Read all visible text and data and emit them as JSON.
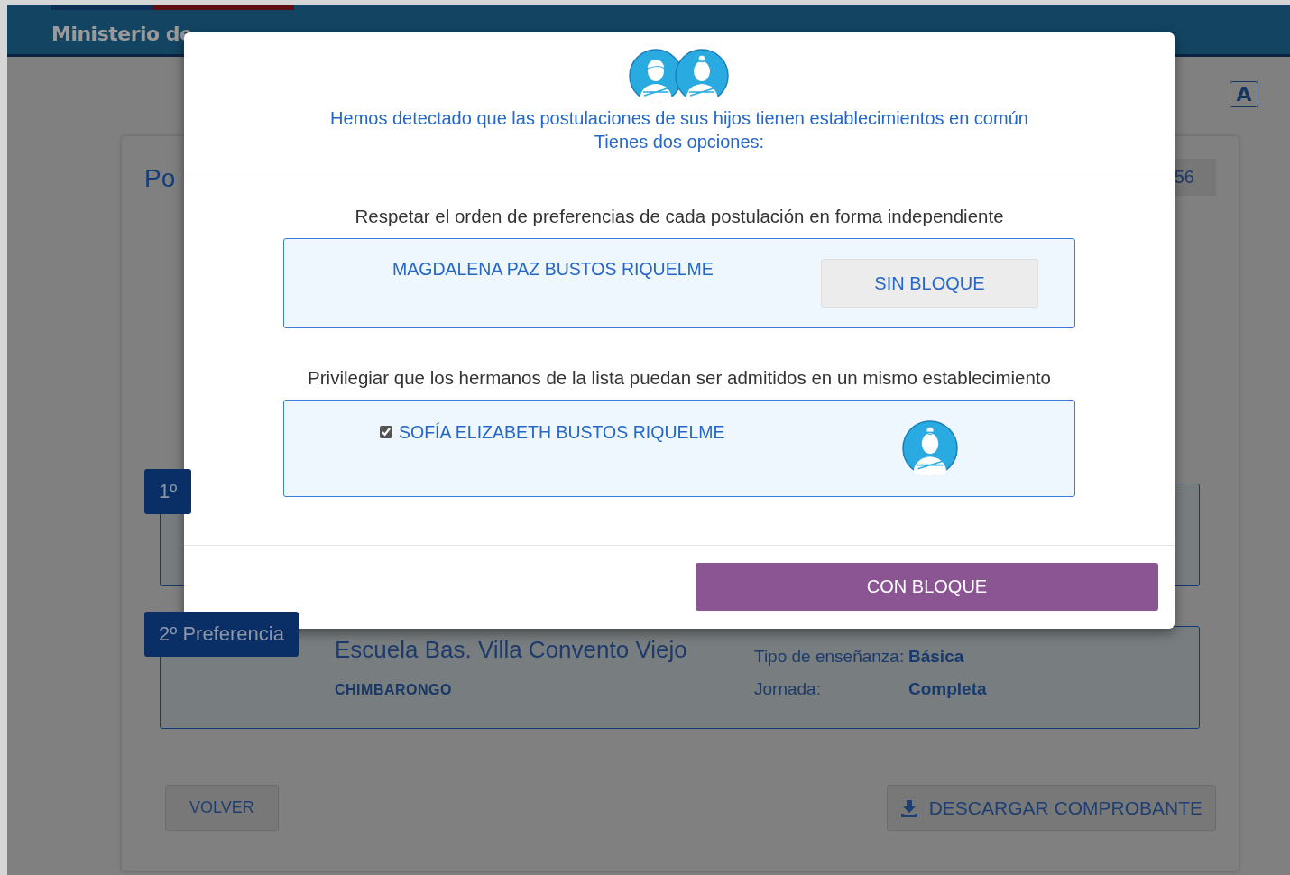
{
  "header": {
    "title": "Ministerio de"
  },
  "font_size_buttons": [
    {
      "label": "A"
    }
  ],
  "page": {
    "title": "Po",
    "badge": "56",
    "preferences": [
      {
        "label": "1º"
      },
      {
        "label": "2º Preferencia",
        "school": "Escuela Bas. Villa Convento Viejo",
        "commune": "CHIMBARONGO",
        "details": [
          {
            "label": "Tipo de enseñanza:",
            "value": "Básica"
          },
          {
            "label": "Jornada:",
            "value": "Completa"
          }
        ]
      }
    ],
    "buttons": [
      {
        "label": "VOLVER",
        "kind": "plain"
      },
      {
        "label": "DESCARGAR COMPROBANTE",
        "kind": "download"
      }
    ]
  },
  "modal": {
    "message": [
      "Hemos detectado que las postulaciones de sus hijos tienen establecimientos en común",
      "Tienes dos opciones:"
    ],
    "options": [
      {
        "title": "Respetar el orden de preferencias de cada postulación en forma independiente",
        "student": "MAGDALENA PAZ BUSTOS RIQUELME",
        "kind": "button",
        "action": "SIN BLOQUE"
      },
      {
        "title": "Privilegiar que los hermanos de la lista puedan ser admitidos en un mismo establecimiento",
        "student": "SOFÍA ELIZABETH BUSTOS RIQUELME",
        "kind": "checkbox",
        "checked": true
      }
    ],
    "confirm": "CON BLOQUE"
  }
}
